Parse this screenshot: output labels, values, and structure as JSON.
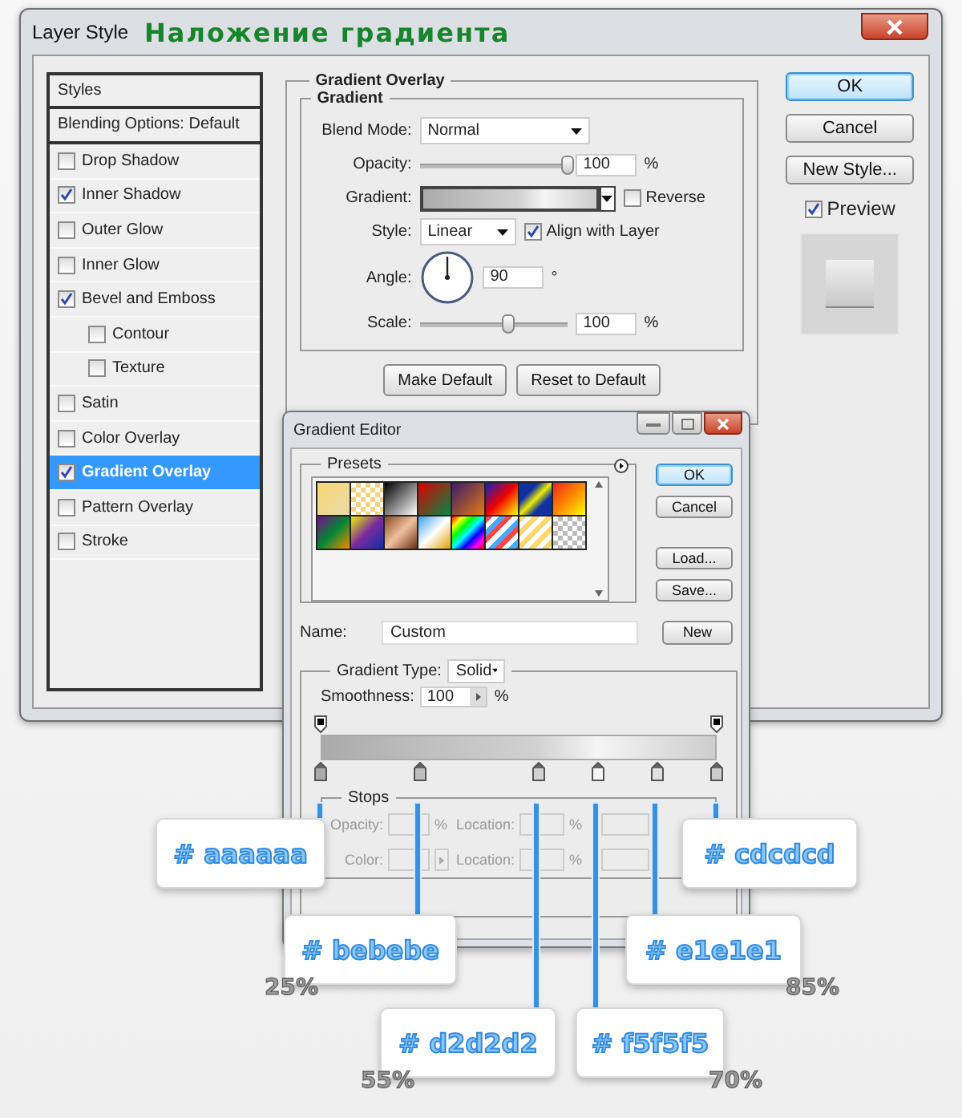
{
  "window": {
    "title": "Layer Style"
  },
  "caption": "Наложение градиента",
  "styles_list": {
    "header": "Styles",
    "blending_options": "Blending Options: Default",
    "items": [
      {
        "label": "Drop Shadow",
        "checked": false,
        "selected": false
      },
      {
        "label": "Inner Shadow",
        "checked": true,
        "selected": false
      },
      {
        "label": "Outer Glow",
        "checked": false,
        "selected": false
      },
      {
        "label": "Inner Glow",
        "checked": false,
        "selected": false
      },
      {
        "label": "Bevel and Emboss",
        "checked": true,
        "selected": false,
        "children": [
          {
            "label": "Contour",
            "checked": false,
            "selected": false
          },
          {
            "label": "Texture",
            "checked": false,
            "selected": false
          }
        ]
      },
      {
        "label": "Satin",
        "checked": false,
        "selected": false
      },
      {
        "label": "Color Overlay",
        "checked": false,
        "selected": false
      },
      {
        "label": "Gradient Overlay",
        "checked": true,
        "selected": true
      },
      {
        "label": "Pattern Overlay",
        "checked": false,
        "selected": false
      },
      {
        "label": "Stroke",
        "checked": false,
        "selected": false
      }
    ]
  },
  "gradient_overlay": {
    "title": "Gradient Overlay",
    "group_title": "Gradient",
    "blend_mode": {
      "label": "Blend Mode:",
      "value": "Normal"
    },
    "opacity": {
      "label": "Opacity:",
      "level": 1,
      "value": "100",
      "unit": "%"
    },
    "gradient": {
      "label": "Gradient:"
    },
    "reverse": {
      "label": "Reverse",
      "checked": false
    },
    "style": {
      "label": "Style:",
      "value": "Linear"
    },
    "align_with_layer": {
      "label": "Align with Layer",
      "checked": true
    },
    "angle": {
      "label": "Angle:",
      "value": "90",
      "unit": "°"
    },
    "scale": {
      "label": "Scale:",
      "level": 0.6,
      "value": "100",
      "unit": "%"
    },
    "buttons": [
      "Make Default",
      "Reset to Default"
    ]
  },
  "dialog_buttons": [
    {
      "label": "OK",
      "default": true
    },
    {
      "label": "Cancel",
      "default": false
    },
    {
      "label": "New Style...",
      "default": false
    }
  ],
  "preview": {
    "label": "Preview",
    "checked": true
  },
  "gradient_editor": {
    "title": "Gradient Editor",
    "presets_title": "Presets",
    "buttons": [
      {
        "label": "OK",
        "default": true
      },
      {
        "label": "Cancel",
        "default": false
      },
      {
        "label": "Load...",
        "default": false
      },
      {
        "label": "Save...",
        "default": false
      }
    ],
    "name_label": "Name:",
    "name_value": "Custom",
    "new_button": "New",
    "type_label": "Gradient Type:",
    "type_value": "Solid",
    "smoothness_label": "Smoothness:",
    "smoothness_value": "100",
    "smoothness_unit": "%",
    "stops_title": "Stops",
    "opacity_row": {
      "label": "Opacity:",
      "unit": "%",
      "location_label": "Location:",
      "location_unit": "%"
    },
    "color_row": {
      "label": "Color:",
      "location_label": "Location:",
      "location_unit": "%"
    }
  },
  "stops": [
    {
      "color": "#aaaaaa",
      "level": 0
    },
    {
      "color": "#bebebe",
      "level": 0.25
    },
    {
      "color": "#d2d2d2",
      "level": 0.55
    },
    {
      "color": "#f5f5f5",
      "level": 0.7
    },
    {
      "color": "#e1e1e1",
      "level": 0.85
    },
    {
      "color": "#cdcdcd",
      "level": 1
    }
  ],
  "callouts": [
    {
      "label": "# aaaaaa"
    },
    {
      "label": "# cdcdcd"
    },
    {
      "label": "# bebebe",
      "percent": "25%"
    },
    {
      "label": "# e1e1e1",
      "percent": "85%"
    },
    {
      "label": "# d2d2d2",
      "percent": "55%"
    },
    {
      "label": "# f5f5f5",
      "percent": "70%"
    }
  ]
}
